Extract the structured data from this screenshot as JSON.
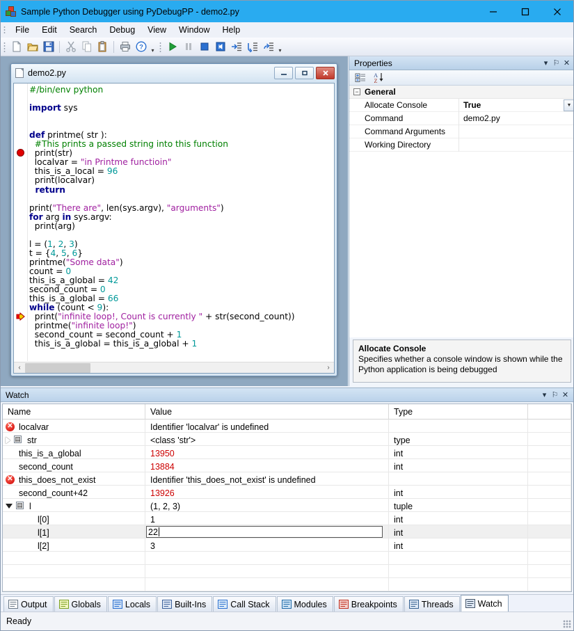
{
  "window": {
    "title": "Sample Python Debugger using PyDebugPP - demo2.py",
    "app_icon": "blocks-icon",
    "minimize": "minimize-icon",
    "maximize": "maximize-icon",
    "close": "close-icon"
  },
  "menubar": {
    "items": [
      {
        "label": "File"
      },
      {
        "label": "Edit"
      },
      {
        "label": "Search"
      },
      {
        "label": "Debug"
      },
      {
        "label": "View"
      },
      {
        "label": "Window"
      },
      {
        "label": "Help"
      }
    ]
  },
  "toolbar": {
    "group1": [
      {
        "name": "new-file-icon",
        "tooltip": "New"
      },
      {
        "name": "open-folder-icon",
        "tooltip": "Open"
      },
      {
        "name": "save-icon",
        "tooltip": "Save"
      }
    ],
    "group2": [
      {
        "name": "cut-icon",
        "tooltip": "Cut"
      },
      {
        "name": "copy-icon",
        "tooltip": "Copy"
      },
      {
        "name": "paste-icon",
        "tooltip": "Paste"
      }
    ],
    "group3": [
      {
        "name": "print-icon",
        "tooltip": "Print"
      },
      {
        "name": "help-icon",
        "tooltip": "Help"
      }
    ],
    "group4": [
      {
        "name": "run-icon",
        "tooltip": "Run"
      },
      {
        "name": "pause-icon",
        "tooltip": "Pause"
      },
      {
        "name": "stop-icon",
        "tooltip": "Stop"
      },
      {
        "name": "restart-icon",
        "tooltip": "Restart"
      },
      {
        "name": "step-into-icon",
        "tooltip": "Step Into"
      },
      {
        "name": "step-over-icon",
        "tooltip": "Step Over"
      },
      {
        "name": "step-out-icon",
        "tooltip": "Step Out"
      }
    ],
    "overflow_label": "▾"
  },
  "editor": {
    "filename": "demo2.py",
    "minimize_label": "–",
    "restore_label": "□",
    "close_label": "✕",
    "scroll_left": "‹",
    "scroll_right": "›",
    "breakpoint_line": 8,
    "current_line": 26,
    "lines": [
      [
        {
          "t": "#/bin/env python",
          "c": "cm"
        }
      ],
      [],
      [
        {
          "t": "import",
          "c": "kw"
        },
        {
          "t": " sys",
          "c": ""
        }
      ],
      [],
      [],
      [
        {
          "t": "def",
          "c": "kw"
        },
        {
          "t": " printme( str ):",
          "c": ""
        }
      ],
      [
        {
          "t": "  #This prints a passed string into this function",
          "c": "cm"
        }
      ],
      [
        {
          "t": "  print(str)",
          "c": ""
        }
      ],
      [
        {
          "t": "  localvar = ",
          "c": ""
        },
        {
          "t": "\"in Printme functioin\"",
          "c": "st"
        }
      ],
      [
        {
          "t": "  this_is_a_local = ",
          "c": ""
        },
        {
          "t": "96",
          "c": "num"
        }
      ],
      [
        {
          "t": "  print(localvar)",
          "c": ""
        }
      ],
      [
        {
          "t": "  return",
          "c": "kw"
        }
      ],
      [],
      [
        {
          "t": "print(",
          "c": ""
        },
        {
          "t": "\"There are\"",
          "c": "st"
        },
        {
          "t": ", len(sys.argv), ",
          "c": ""
        },
        {
          "t": "\"arguments\"",
          "c": "st"
        },
        {
          "t": ")",
          "c": ""
        }
      ],
      [
        {
          "t": "for",
          "c": "kw"
        },
        {
          "t": " arg ",
          "c": ""
        },
        {
          "t": "in",
          "c": "kw"
        },
        {
          "t": " sys.argv:",
          "c": ""
        }
      ],
      [
        {
          "t": "  print(arg)",
          "c": ""
        }
      ],
      [],
      [
        {
          "t": "l = (",
          "c": ""
        },
        {
          "t": "1",
          "c": "num"
        },
        {
          "t": ", ",
          "c": ""
        },
        {
          "t": "2",
          "c": "num"
        },
        {
          "t": ", ",
          "c": ""
        },
        {
          "t": "3",
          "c": "num"
        },
        {
          "t": ")",
          "c": ""
        }
      ],
      [
        {
          "t": "t = {",
          "c": ""
        },
        {
          "t": "4",
          "c": "num"
        },
        {
          "t": ", ",
          "c": ""
        },
        {
          "t": "5",
          "c": "num"
        },
        {
          "t": ", ",
          "c": ""
        },
        {
          "t": "6",
          "c": "num"
        },
        {
          "t": "}",
          "c": ""
        }
      ],
      [
        {
          "t": "printme(",
          "c": ""
        },
        {
          "t": "\"Some data\"",
          "c": "st"
        },
        {
          "t": ")",
          "c": ""
        }
      ],
      [
        {
          "t": "count = ",
          "c": ""
        },
        {
          "t": "0",
          "c": "num"
        }
      ],
      [
        {
          "t": "this_is_a_global = ",
          "c": ""
        },
        {
          "t": "42",
          "c": "num"
        }
      ],
      [
        {
          "t": "second_count = ",
          "c": ""
        },
        {
          "t": "0",
          "c": "num"
        }
      ],
      [
        {
          "t": "this_is_a_global = ",
          "c": ""
        },
        {
          "t": "66",
          "c": "num"
        }
      ],
      [
        {
          "t": "while",
          "c": "kw"
        },
        {
          "t": " (count < ",
          "c": ""
        },
        {
          "t": "9",
          "c": "num"
        },
        {
          "t": "):",
          "c": ""
        }
      ],
      [
        {
          "t": "  print(",
          "c": ""
        },
        {
          "t": "\"infinite loop!, Count is currently \"",
          "c": "st"
        },
        {
          "t": " + str(second_count))",
          "c": ""
        }
      ],
      [
        {
          "t": "  printme(",
          "c": ""
        },
        {
          "t": "\"infinite loop!\"",
          "c": "st"
        },
        {
          "t": ")",
          "c": ""
        }
      ],
      [
        {
          "t": "  second_count = second_count + ",
          "c": ""
        },
        {
          "t": "1",
          "c": "num"
        }
      ],
      [
        {
          "t": "  this_is_a_global = this_is_a_global + ",
          "c": ""
        },
        {
          "t": "1",
          "c": "num"
        }
      ]
    ]
  },
  "properties": {
    "title": "Properties",
    "dropdown_label": "▾",
    "pin_label": "⚐",
    "close_label": "✕",
    "toolbar": [
      {
        "name": "categorized-view-icon"
      },
      {
        "name": "alphabetical-sort-icon"
      }
    ],
    "category": {
      "label": "General",
      "expander": "−"
    },
    "rows": [
      {
        "name": "Allocate Console",
        "value": "True",
        "has_dropdown": true,
        "selected": true
      },
      {
        "name": "Command",
        "value": "demo2.py",
        "has_dropdown": false,
        "selected": false
      },
      {
        "name": "Command Arguments",
        "value": "",
        "has_dropdown": false,
        "selected": false
      },
      {
        "name": "Working Directory",
        "value": "",
        "has_dropdown": false,
        "selected": false
      }
    ],
    "description": {
      "title": "Allocate Console",
      "text": "Specifies whether a console window is shown while the Python application is being debugged"
    }
  },
  "watch": {
    "title": "Watch",
    "dropdown_label": "▾",
    "pin_label": "⚐",
    "close_label": "✕",
    "columns": [
      "Name",
      "Value",
      "Type"
    ],
    "rows": [
      {
        "icon": "error-icon",
        "indent": 0,
        "tree": "none",
        "name": "localvar",
        "value": "Identifier 'localvar' is undefined",
        "value_style": "text",
        "type": "",
        "editing": false,
        "selected": false
      },
      {
        "icon": "tree-icon",
        "indent": 0,
        "tree": "closed",
        "name": "str",
        "value": "<class 'str'>",
        "value_style": "text",
        "type": "type",
        "editing": false,
        "selected": false
      },
      {
        "icon": "variable-icon",
        "indent": 0,
        "tree": "none",
        "name": "this_is_a_global",
        "value": "13950",
        "value_style": "num",
        "type": "int",
        "editing": false,
        "selected": false
      },
      {
        "icon": "variable-icon",
        "indent": 0,
        "tree": "none",
        "name": "second_count",
        "value": "13884",
        "value_style": "num",
        "type": "int",
        "editing": false,
        "selected": false
      },
      {
        "icon": "error-icon",
        "indent": 0,
        "tree": "none",
        "name": "this_does_not_exist",
        "value": "Identifier 'this_does_not_exist' is undefined",
        "value_style": "text",
        "type": "",
        "editing": false,
        "selected": false
      },
      {
        "icon": "variable-icon",
        "indent": 0,
        "tree": "none",
        "name": "second_count+42",
        "value": "13926",
        "value_style": "num",
        "type": "int",
        "editing": false,
        "selected": false
      },
      {
        "icon": "tree-icon",
        "indent": 0,
        "tree": "open",
        "name": "l",
        "value": "(1, 2, 3)",
        "value_style": "text",
        "type": "tuple",
        "editing": false,
        "selected": false
      },
      {
        "icon": "variable-icon",
        "indent": 1,
        "tree": "none",
        "name": "l[0]",
        "value": "1",
        "value_style": "text",
        "type": "int",
        "editing": false,
        "selected": false
      },
      {
        "icon": "variable-icon",
        "indent": 1,
        "tree": "none",
        "name": "l[1]",
        "value": "22",
        "value_style": "text",
        "type": "int",
        "editing": true,
        "selected": true
      },
      {
        "icon": "variable-icon",
        "indent": 1,
        "tree": "none",
        "name": "l[2]",
        "value": "3",
        "value_style": "text",
        "type": "int",
        "editing": false,
        "selected": false
      }
    ],
    "empty_rows": 3
  },
  "tabs": [
    {
      "label": "Output",
      "icon": "output-icon",
      "active": false
    },
    {
      "label": "Globals",
      "icon": "globals-icon",
      "active": false
    },
    {
      "label": "Locals",
      "icon": "locals-icon",
      "active": false
    },
    {
      "label": "Built-Ins",
      "icon": "builtins-icon",
      "active": false
    },
    {
      "label": "Call Stack",
      "icon": "callstack-icon",
      "active": false
    },
    {
      "label": "Modules",
      "icon": "modules-icon",
      "active": false
    },
    {
      "label": "Breakpoints",
      "icon": "breakpoints-icon",
      "active": false
    },
    {
      "label": "Threads",
      "icon": "threads-icon",
      "active": false
    },
    {
      "label": "Watch",
      "icon": "watch-icon",
      "active": true
    }
  ],
  "statusbar": {
    "text": "Ready"
  },
  "colors": {
    "title_bar": "#29abf0",
    "keyword": "#00008b",
    "comment": "#008000",
    "string": "#a020a0",
    "number": "#009999",
    "watch_number": "#cc0000",
    "breakpoint": "#e00000"
  }
}
